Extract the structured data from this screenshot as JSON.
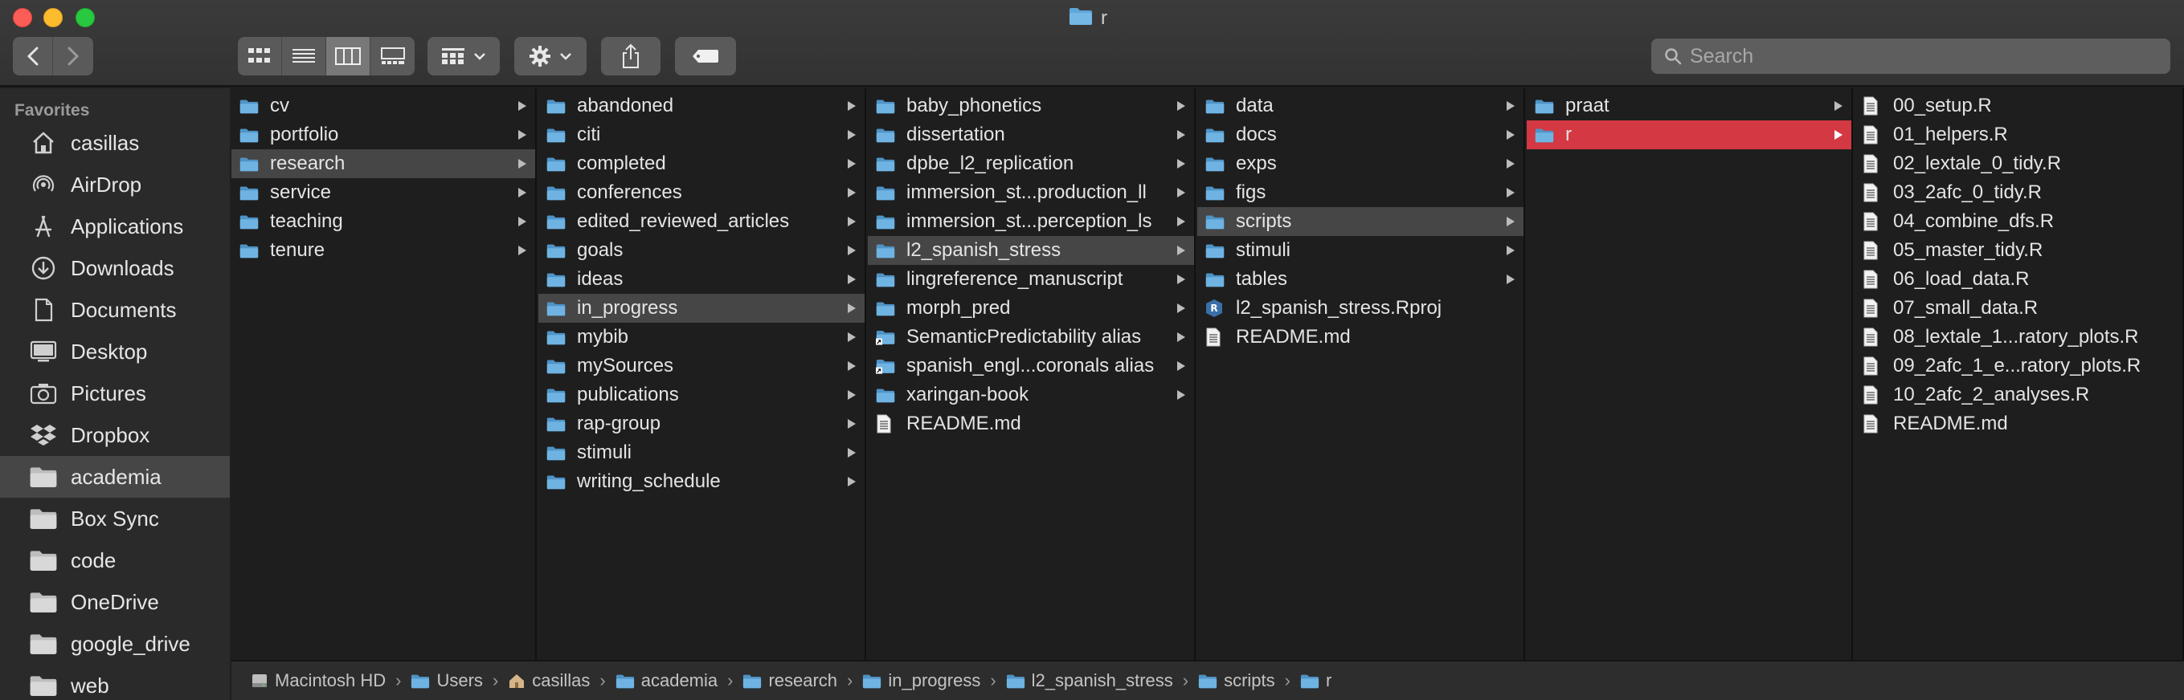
{
  "window": {
    "title": "r"
  },
  "toolbar": {
    "back_icon": "chevron-left-icon",
    "forward_icon": "chevron-right-icon",
    "view_modes": [
      "icon-view",
      "list-view",
      "column-view",
      "gallery-view"
    ],
    "active_view": "column-view",
    "group_icon": "group-by-icon",
    "action_icon": "gear-icon",
    "share_icon": "share-icon",
    "tag_icon": "tag-icon"
  },
  "search": {
    "placeholder": "Search"
  },
  "sidebar": {
    "header": "Favorites",
    "items": [
      {
        "label": "casillas",
        "icon": "home-icon"
      },
      {
        "label": "AirDrop",
        "icon": "airdrop-icon"
      },
      {
        "label": "Applications",
        "icon": "applications-icon"
      },
      {
        "label": "Downloads",
        "icon": "downloads-icon"
      },
      {
        "label": "Documents",
        "icon": "documents-icon"
      },
      {
        "label": "Desktop",
        "icon": "desktop-icon"
      },
      {
        "label": "Pictures",
        "icon": "camera-icon"
      },
      {
        "label": "Dropbox",
        "icon": "dropbox-icon"
      },
      {
        "label": "academia",
        "icon": "folder-icon",
        "selected": true
      },
      {
        "label": "Box Sync",
        "icon": "folder-icon"
      },
      {
        "label": "code",
        "icon": "folder-icon"
      },
      {
        "label": "OneDrive",
        "icon": "folder-icon"
      },
      {
        "label": "google_drive",
        "icon": "folder-icon"
      },
      {
        "label": "web",
        "icon": "folder-icon"
      }
    ]
  },
  "columns": [
    {
      "items": [
        {
          "label": "cv",
          "type": "folder",
          "arrow": true
        },
        {
          "label": "portfolio",
          "type": "folder",
          "arrow": true
        },
        {
          "label": "research",
          "type": "folder",
          "arrow": true,
          "state": "highlighted"
        },
        {
          "label": "service",
          "type": "folder",
          "arrow": true
        },
        {
          "label": "teaching",
          "type": "folder",
          "arrow": true
        },
        {
          "label": "tenure",
          "type": "folder",
          "arrow": true
        }
      ]
    },
    {
      "items": [
        {
          "label": "abandoned",
          "type": "folder",
          "arrow": true
        },
        {
          "label": "citi",
          "type": "folder",
          "arrow": true
        },
        {
          "label": "completed",
          "type": "folder",
          "arrow": true
        },
        {
          "label": "conferences",
          "type": "folder",
          "arrow": true
        },
        {
          "label": "edited_reviewed_articles",
          "type": "folder",
          "arrow": true
        },
        {
          "label": "goals",
          "type": "folder",
          "arrow": true
        },
        {
          "label": "ideas",
          "type": "folder",
          "arrow": true
        },
        {
          "label": "in_progress",
          "type": "folder",
          "arrow": true,
          "state": "highlighted"
        },
        {
          "label": "mybib",
          "type": "folder",
          "arrow": true
        },
        {
          "label": "mySources",
          "type": "folder",
          "arrow": true
        },
        {
          "label": "publications",
          "type": "folder",
          "arrow": true
        },
        {
          "label": "rap-group",
          "type": "folder",
          "arrow": true
        },
        {
          "label": "stimuli",
          "type": "folder",
          "arrow": true
        },
        {
          "label": "writing_schedule",
          "type": "folder",
          "arrow": true
        }
      ]
    },
    {
      "items": [
        {
          "label": "baby_phonetics",
          "type": "folder",
          "arrow": true
        },
        {
          "label": "dissertation",
          "type": "folder",
          "arrow": true
        },
        {
          "label": "dpbe_l2_replication",
          "type": "folder",
          "arrow": true
        },
        {
          "label": "immersion_st...production_ll",
          "type": "folder",
          "arrow": true
        },
        {
          "label": "immersion_st...perception_ls",
          "type": "folder",
          "arrow": true
        },
        {
          "label": "l2_spanish_stress",
          "type": "folder",
          "arrow": true,
          "state": "highlighted"
        },
        {
          "label": "lingreference_manuscript",
          "type": "folder",
          "arrow": true
        },
        {
          "label": "morph_pred",
          "type": "folder",
          "arrow": true
        },
        {
          "label": "SemanticPredictability alias",
          "type": "alias",
          "arrow": true
        },
        {
          "label": "spanish_engl...coronals alias",
          "type": "alias",
          "arrow": true
        },
        {
          "label": "xaringan-book",
          "type": "folder",
          "arrow": true
        },
        {
          "label": "README.md",
          "type": "file",
          "arrow": false
        }
      ]
    },
    {
      "items": [
        {
          "label": "data",
          "type": "folder",
          "arrow": true
        },
        {
          "label": "docs",
          "type": "folder",
          "arrow": true
        },
        {
          "label": "exps",
          "type": "folder",
          "arrow": true
        },
        {
          "label": "figs",
          "type": "folder",
          "arrow": true
        },
        {
          "label": "scripts",
          "type": "folder",
          "arrow": true,
          "state": "highlighted"
        },
        {
          "label": "stimuli",
          "type": "folder",
          "arrow": true
        },
        {
          "label": "tables",
          "type": "folder",
          "arrow": true
        },
        {
          "label": "l2_spanish_stress.Rproj",
          "type": "rproj",
          "arrow": false
        },
        {
          "label": "README.md",
          "type": "file",
          "arrow": false
        }
      ]
    },
    {
      "items": [
        {
          "label": "praat",
          "type": "folder",
          "arrow": true
        },
        {
          "label": "r",
          "type": "folder",
          "arrow": true,
          "state": "selected"
        }
      ]
    },
    {
      "items": [
        {
          "label": "00_setup.R",
          "type": "file",
          "arrow": false
        },
        {
          "label": "01_helpers.R",
          "type": "file",
          "arrow": false
        },
        {
          "label": "02_lextale_0_tidy.R",
          "type": "file",
          "arrow": false
        },
        {
          "label": "03_2afc_0_tidy.R",
          "type": "file",
          "arrow": false
        },
        {
          "label": "04_combine_dfs.R",
          "type": "file",
          "arrow": false
        },
        {
          "label": "05_master_tidy.R",
          "type": "file",
          "arrow": false
        },
        {
          "label": "06_load_data.R",
          "type": "file",
          "arrow": false
        },
        {
          "label": "07_small_data.R",
          "type": "file",
          "arrow": false
        },
        {
          "label": "08_lextale_1...ratory_plots.R",
          "type": "file",
          "arrow": false
        },
        {
          "label": "09_2afc_1_e...ratory_plots.R",
          "type": "file",
          "arrow": false
        },
        {
          "label": "10_2afc_2_analyses.R",
          "type": "file",
          "arrow": false
        },
        {
          "label": "README.md",
          "type": "file",
          "arrow": false
        }
      ]
    }
  ],
  "pathbar": [
    {
      "label": "Macintosh HD",
      "icon": "hard-drive-icon"
    },
    {
      "label": "Users",
      "icon": "folder-icon"
    },
    {
      "label": "casillas",
      "icon": "home-icon"
    },
    {
      "label": "academia",
      "icon": "folder-icon"
    },
    {
      "label": "research",
      "icon": "folder-icon"
    },
    {
      "label": "in_progress",
      "icon": "folder-icon"
    },
    {
      "label": "l2_spanish_stress",
      "icon": "folder-icon"
    },
    {
      "label": "scripts",
      "icon": "folder-icon"
    },
    {
      "label": "r",
      "icon": "folder-icon"
    }
  ],
  "colors": {
    "folder": "#5ea6d8",
    "selection": "#d33843",
    "highlight": "#464646"
  }
}
